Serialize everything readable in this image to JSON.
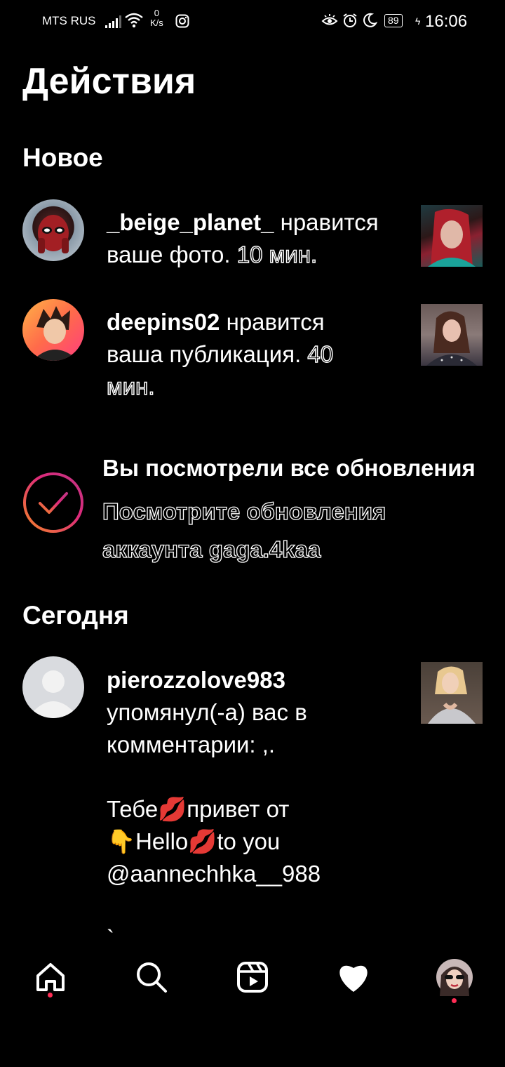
{
  "status_bar": {
    "carrier": "MTS RUS",
    "speed_value": "0",
    "speed_unit": "K/s",
    "battery": "89",
    "time": "16:06"
  },
  "page": {
    "title": "Действия"
  },
  "sections": {
    "new": "Новое",
    "today": "Сегодня"
  },
  "notifications": [
    {
      "username": "_beige_planet_",
      "line1_rest": "нравится",
      "line2_text": "ваше фото.",
      "line2_time": "10 мин."
    },
    {
      "username": "deepins02",
      "line1_rest": "нравится",
      "line2_text": "ваша публикация.",
      "line2_time": "40",
      "line3_time": "мин."
    }
  ],
  "caught_up": {
    "title": "Вы посмотрели все обновления",
    "line1": "Посмотрите обновления",
    "line2": "аккаунта gaga.4kaa"
  },
  "mention": {
    "username": "pierozzolove983",
    "lines": [
      "упомянул(-а) вас в",
      "комментарии: ,.",
      "",
      " Тебе💋привет от",
      "👇Hello💋to you",
      "@aannechhka__988",
      "",
      "`"
    ]
  },
  "nav": {
    "items": [
      "home-icon",
      "search-icon",
      "reels-icon",
      "heart-icon",
      "profile-avatar"
    ]
  },
  "colors": {
    "background": "#000000",
    "notification_dot": "#ff2d55",
    "ring_start": "#f58529",
    "ring_end": "#dd2a7b"
  }
}
